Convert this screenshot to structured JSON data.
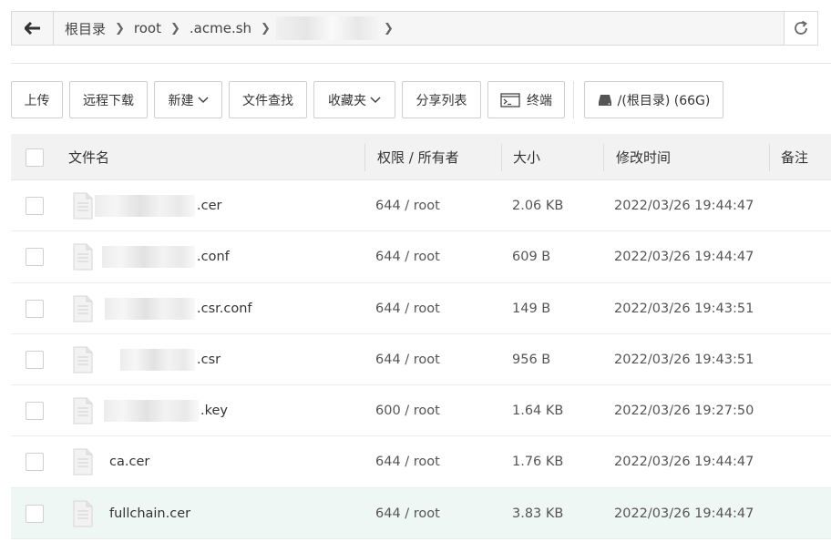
{
  "breadcrumb": {
    "items": [
      "根目录",
      "root",
      ".acme.sh"
    ]
  },
  "toolbar": {
    "upload": "上传",
    "remote_download": "远程下载",
    "new": "新建",
    "file_search": "文件查找",
    "favorites": "收藏夹",
    "share_list": "分享列表",
    "terminal": "终端",
    "disk": "/(根目录) (66G)"
  },
  "table": {
    "headers": {
      "name": "文件名",
      "perm": "权限 / 所有者",
      "size": "大小",
      "mtime": "修改时间",
      "note": "备注"
    },
    "rows": [
      {
        "name": ".cer",
        "perm": "644 / root",
        "size": "2.06 KB",
        "mtime": "2022/03/26 19:44:47"
      },
      {
        "name": ".conf",
        "perm": "644 / root",
        "size": "609 B",
        "mtime": "2022/03/26 19:44:47"
      },
      {
        "name": ".csr.conf",
        "perm": "644 / root",
        "size": "149 B",
        "mtime": "2022/03/26 19:43:51"
      },
      {
        "name": ".csr",
        "perm": "644 / root",
        "size": "956 B",
        "mtime": "2022/03/26 19:43:51"
      },
      {
        "name": ".key",
        "perm": "600 / root",
        "size": "1.64 KB",
        "mtime": "2022/03/26 19:27:50"
      },
      {
        "name": "ca.cer",
        "perm": "644 / root",
        "size": "1.76 KB",
        "mtime": "2022/03/26 19:44:47"
      },
      {
        "name": "fullchain.cer",
        "perm": "644 / root",
        "size": "3.83 KB",
        "mtime": "2022/03/26 19:44:47"
      }
    ]
  },
  "icons": {
    "back": "arrow-left-icon",
    "refresh": "refresh-icon",
    "terminal": "terminal-icon",
    "disk": "disk-icon",
    "file": "file-icon"
  }
}
